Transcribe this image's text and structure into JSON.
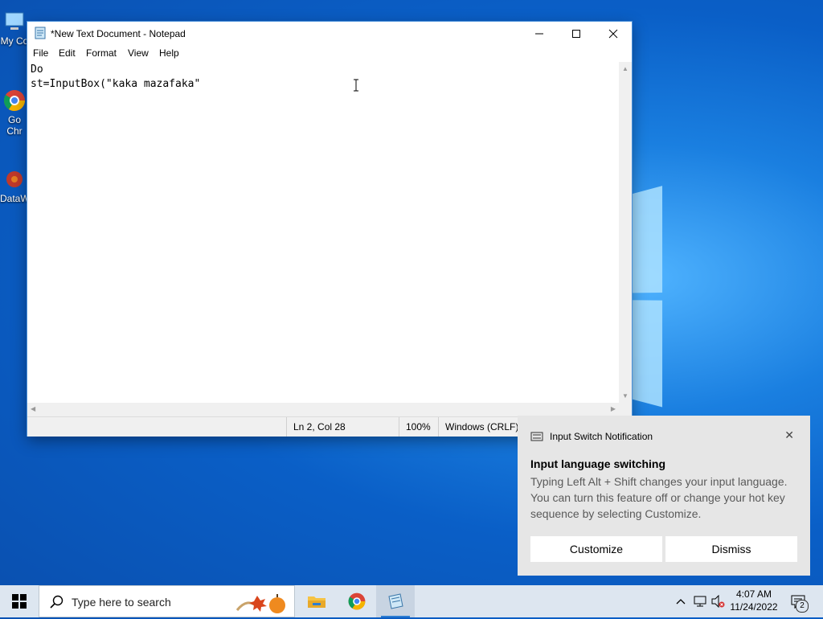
{
  "desktop": {
    "icons": [
      {
        "label": "My Co",
        "icon": "computer-icon"
      },
      {
        "label": "Go\nChr",
        "icon": "chrome-icon"
      },
      {
        "label": "DataW",
        "icon": "datawrapper-icon"
      }
    ]
  },
  "notepad": {
    "title": "*New Text Document - Notepad",
    "menu": [
      "File",
      "Edit",
      "Format",
      "View",
      "Help"
    ],
    "lines": [
      "Do",
      "st=InputBox(\"kaka mazafaka\""
    ],
    "status": {
      "position": "Ln 2, Col 28",
      "zoom": "100%",
      "line_ending": "Windows (CRLF)"
    }
  },
  "notification": {
    "header": "Input Switch Notification",
    "title": "Input language switching",
    "body": "Typing Left Alt + Shift changes your input language. You can turn this feature off or change your hot key sequence by selecting Customize.",
    "buttons": {
      "customize": "Customize",
      "dismiss": "Dismiss"
    }
  },
  "taskbar": {
    "search_placeholder": "Type here to search",
    "time": "4:07 AM",
    "date": "11/24/2022",
    "notifications_count": "2",
    "colors": {
      "accent": "#2d7dd2",
      "taskbar_bg": "#dde6f0"
    }
  }
}
